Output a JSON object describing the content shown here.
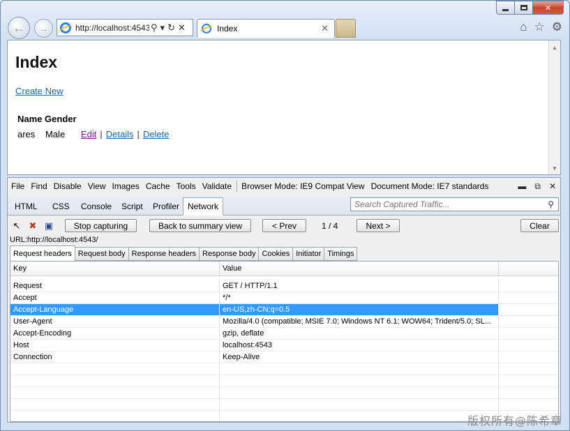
{
  "browser": {
    "address_url": "http://localhost:4543/",
    "tab_title": "Index",
    "caption": {
      "minimize": "—",
      "maximize": "□",
      "close": "✕"
    }
  },
  "page": {
    "title": "Index",
    "create_link": "Create New",
    "grid": {
      "headers": [
        "Name",
        "Gender"
      ],
      "rows": [
        {
          "name": "ares",
          "gender": "Male",
          "edit": "Edit",
          "details": "Details",
          "delete": "Delete"
        }
      ]
    }
  },
  "devtools": {
    "menu": [
      "File",
      "Find",
      "Disable",
      "View",
      "Images",
      "Cache",
      "Tools",
      "Validate"
    ],
    "browser_mode_label": "Browser Mode: IE9 Compat View",
    "document_mode_label": "Document Mode: IE7 standards",
    "tabs": [
      "HTML",
      "CSS",
      "Console",
      "Script",
      "Profiler",
      "Network"
    ],
    "active_tab": "Network",
    "search_placeholder": "Search Captured Traffic...",
    "toolbar": {
      "stop_capturing": "Stop capturing",
      "back_to_summary": "Back to summary view",
      "prev": "< Prev",
      "page_indicator": "1 / 4",
      "next": "Next >",
      "clear": "Clear"
    },
    "url_line": "URL:http://localhost:4543/",
    "sub_tabs": [
      "Request headers",
      "Request body",
      "Response headers",
      "Response body",
      "Cookies",
      "Initiator",
      "Timings"
    ],
    "active_sub_tab": "Request headers",
    "headers_table": {
      "columns": [
        "Key",
        "Value"
      ],
      "rows": [
        {
          "key": "Request",
          "value": "GET / HTTP/1.1"
        },
        {
          "key": "Accept",
          "value": "*/*"
        },
        {
          "key": "Accept-Language",
          "value": "en-US,zh-CN;q=0.5",
          "selected": true
        },
        {
          "key": "User-Agent",
          "value": "Mozilla/4.0 (compatible; MSIE 7.0; Windows NT 6.1; WOW64; Trident/5.0; SL..."
        },
        {
          "key": "Accept-Encoding",
          "value": "gzip, deflate"
        },
        {
          "key": "Host",
          "value": "localhost:4543"
        },
        {
          "key": "Connection",
          "value": "Keep-Alive"
        },
        {
          "key": "",
          "value": ""
        },
        {
          "key": "",
          "value": ""
        },
        {
          "key": "",
          "value": ""
        },
        {
          "key": "",
          "value": ""
        },
        {
          "key": "",
          "value": ""
        }
      ]
    }
  },
  "watermark": "版权所有@陈希章",
  "colors": {
    "selection": "#3399ff",
    "link": "#1569b2",
    "visited_link": "#7b1a87"
  }
}
